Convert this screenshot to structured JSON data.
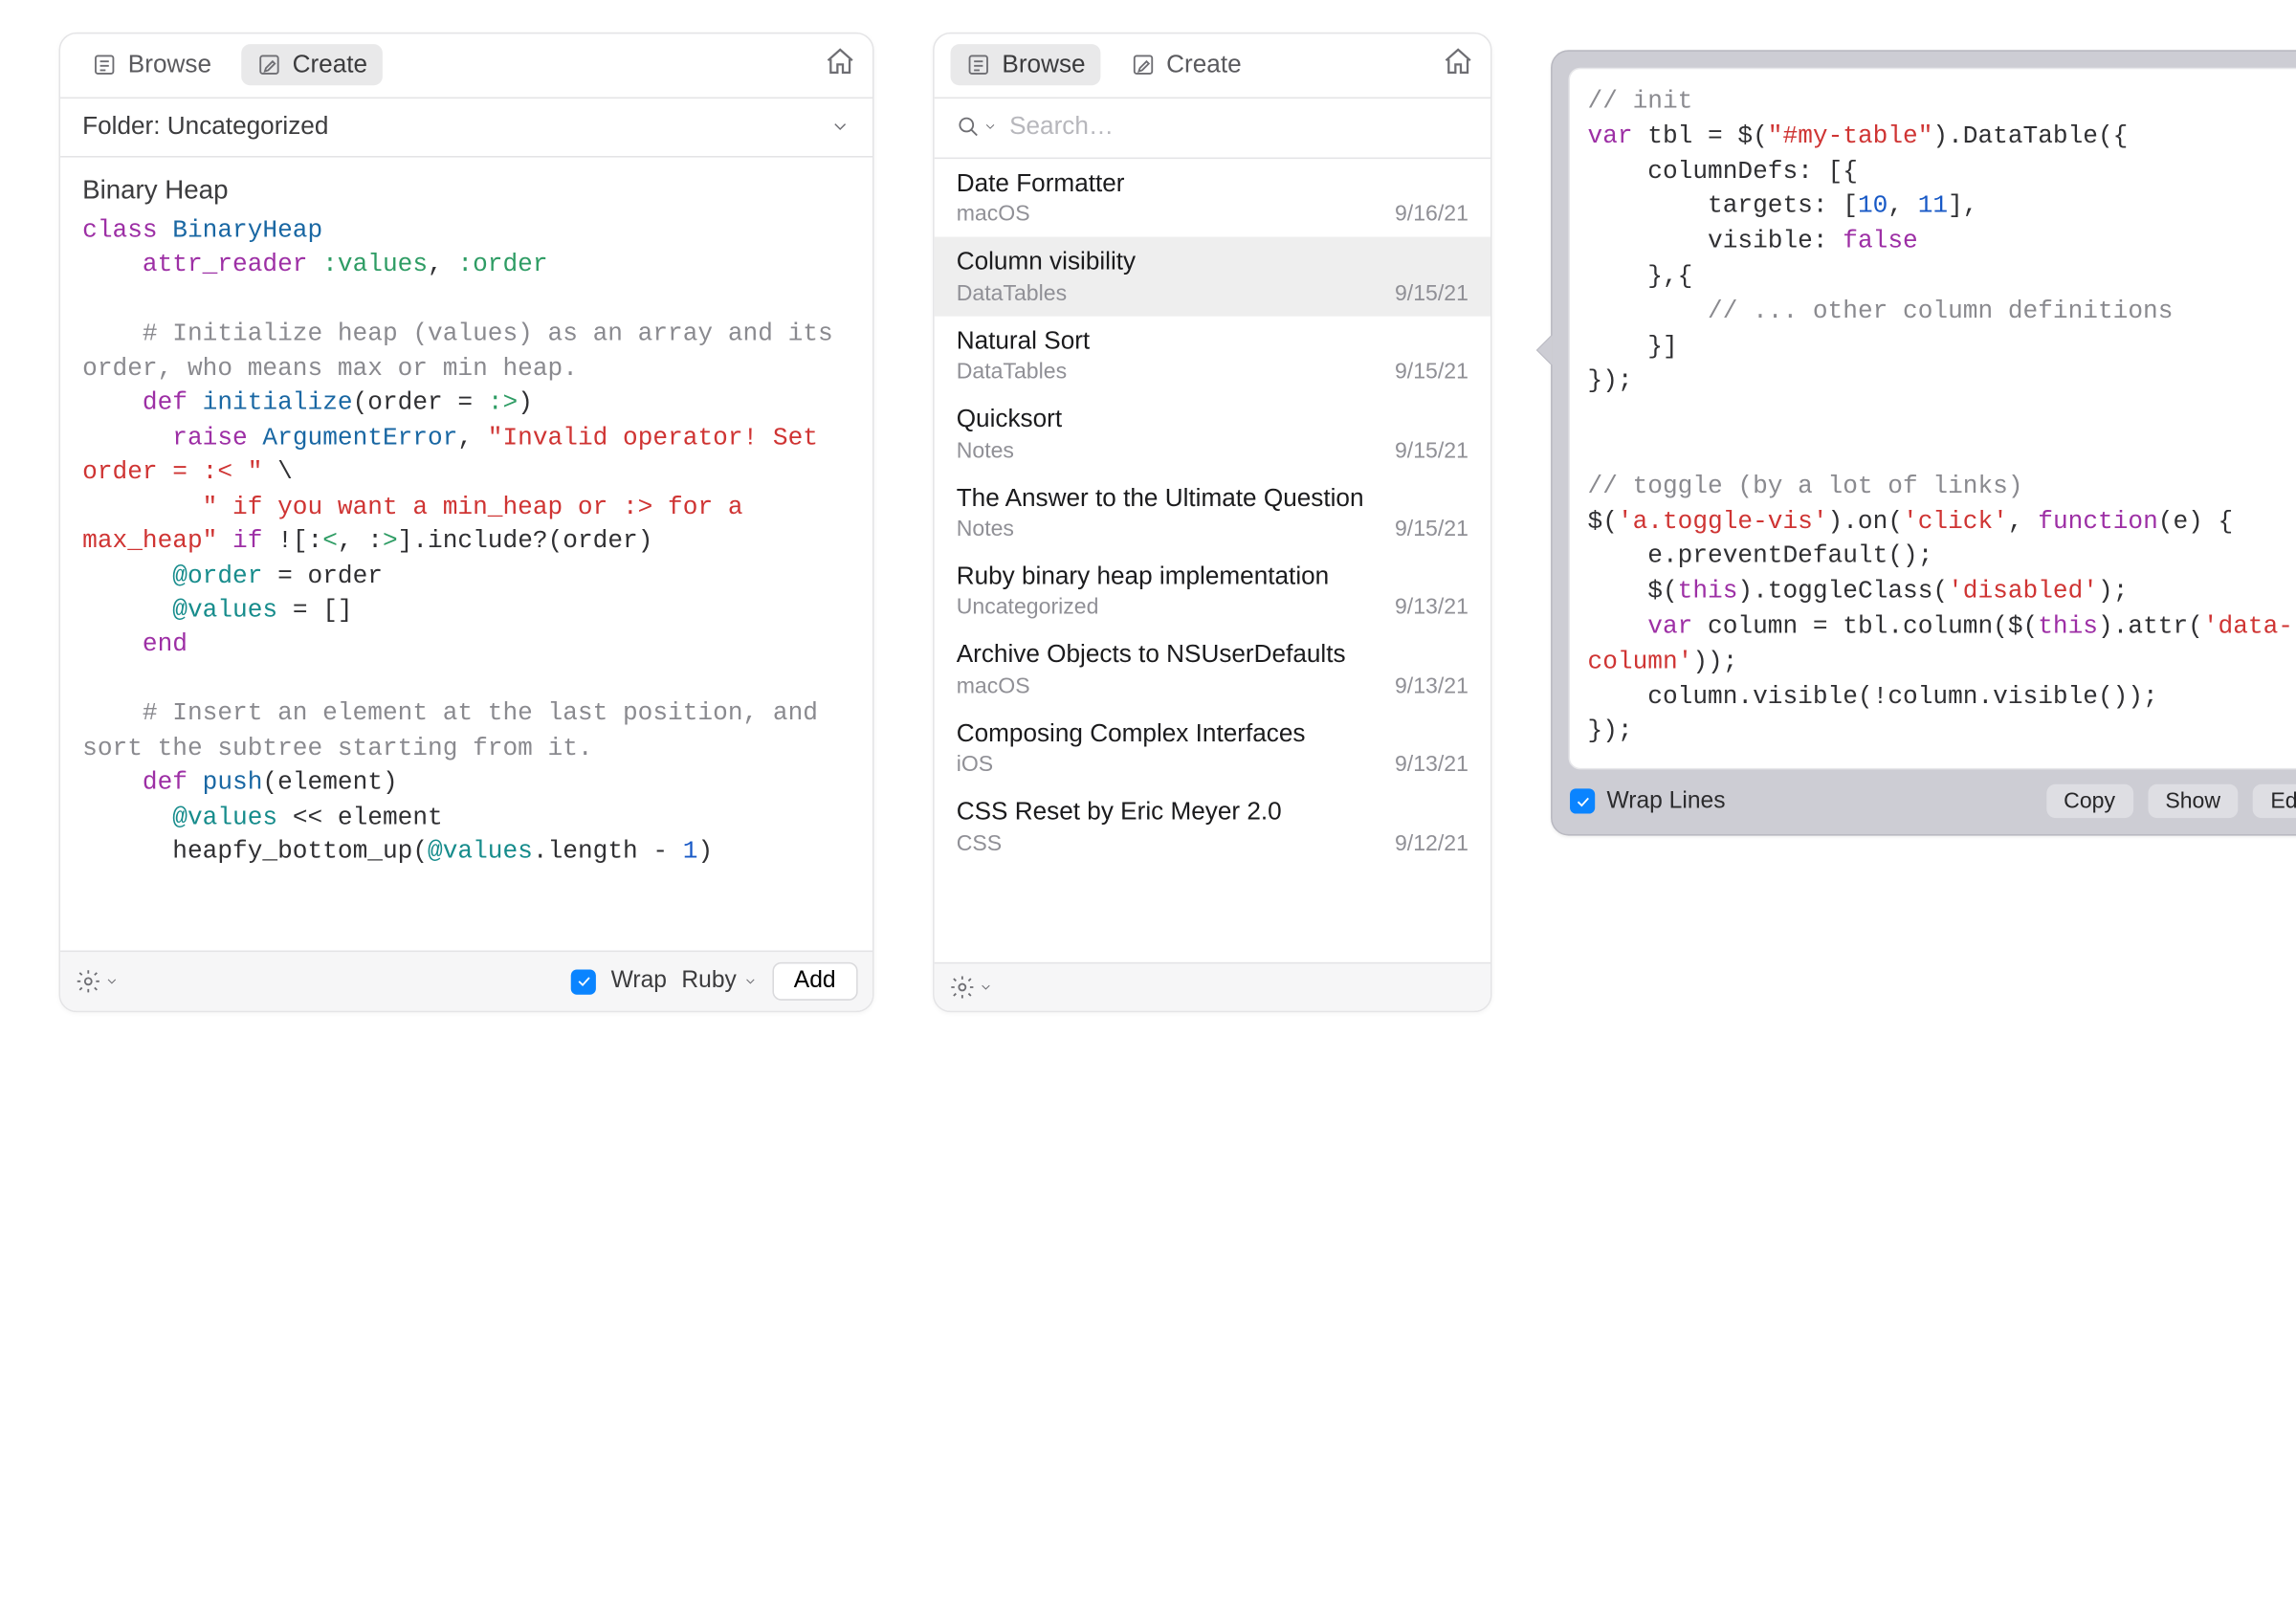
{
  "panel1": {
    "browse": "Browse",
    "create": "Create",
    "folder_label": "Folder: Uncategorized",
    "title": "Binary Heap",
    "footer": {
      "wrap_label": "Wrap",
      "lang": "Ruby",
      "add": "Add"
    },
    "code_tokens": [
      [
        [
          "kw",
          "class"
        ],
        [
          "",
          " "
        ],
        [
          "dfn",
          "BinaryHeap"
        ]
      ],
      [
        [
          "",
          "    "
        ],
        [
          "kw",
          "attr_reader"
        ],
        [
          "",
          " "
        ],
        [
          "sym",
          ":values"
        ],
        [
          "",
          ", "
        ],
        [
          "sym",
          ":order"
        ]
      ],
      [],
      [
        [
          "",
          "    "
        ],
        [
          "cmt",
          "# Initialize heap (values) as an array and its order, who means max or min heap."
        ]
      ],
      [
        [
          "",
          "    "
        ],
        [
          "kw",
          "def"
        ],
        [
          "",
          " "
        ],
        [
          "dfn",
          "initialize"
        ],
        [
          "",
          "(order = "
        ],
        [
          "sym",
          ":>"
        ],
        [
          "",
          ")"
        ]
      ],
      [
        [
          "",
          "      "
        ],
        [
          "kw",
          "raise"
        ],
        [
          "",
          " "
        ],
        [
          "dfn",
          "ArgumentError"
        ],
        [
          "",
          ", "
        ],
        [
          "str",
          "\"Invalid operator! Set order = :< \""
        ],
        [
          "",
          " \\"
        ]
      ],
      [
        [
          "",
          "        "
        ],
        [
          "str",
          "\" if you want a min_heap or :> for a max_heap\""
        ],
        [
          "",
          " "
        ],
        [
          "kw",
          "if"
        ],
        [
          "",
          " ![:"
        ],
        [
          "sym",
          "<"
        ],
        [
          "",
          ", :"
        ],
        [
          "sym",
          ">"
        ],
        [
          "",
          "].include?(order)"
        ]
      ],
      [
        [
          "",
          "      "
        ],
        [
          "atr",
          "@order"
        ],
        [
          "",
          " = order"
        ]
      ],
      [
        [
          "",
          "      "
        ],
        [
          "atr",
          "@values"
        ],
        [
          "",
          " = []"
        ]
      ],
      [
        [
          "",
          "    "
        ],
        [
          "kw",
          "end"
        ]
      ],
      [],
      [
        [
          "",
          "    "
        ],
        [
          "cmt",
          "# Insert an element at the last position, and sort the subtree starting from it."
        ]
      ],
      [
        [
          "",
          "    "
        ],
        [
          "kw",
          "def"
        ],
        [
          "",
          " "
        ],
        [
          "dfn",
          "push"
        ],
        [
          "",
          "(element)"
        ]
      ],
      [
        [
          "",
          "      "
        ],
        [
          "atr",
          "@values"
        ],
        [
          "",
          " << element"
        ]
      ],
      [
        [
          "",
          "      heapfy_bottom_up("
        ],
        [
          "atr",
          "@values"
        ],
        [
          "",
          ".length - "
        ],
        [
          "num",
          "1"
        ],
        [
          "",
          ")"
        ]
      ]
    ]
  },
  "panel2": {
    "browse": "Browse",
    "create": "Create",
    "search_placeholder": "Search…",
    "items": [
      {
        "title": "Date Formatter",
        "folder": "macOS",
        "date": "9/16/21",
        "sel": false
      },
      {
        "title": "Column visibility",
        "folder": "DataTables",
        "date": "9/15/21",
        "sel": true
      },
      {
        "title": "Natural Sort",
        "folder": "DataTables",
        "date": "9/15/21",
        "sel": false
      },
      {
        "title": "Quicksort",
        "folder": "Notes",
        "date": "9/15/21",
        "sel": false
      },
      {
        "title": "The Answer to the Ultimate Question",
        "folder": "Notes",
        "date": "9/15/21",
        "sel": false
      },
      {
        "title": "Ruby binary heap implementation",
        "folder": "Uncategorized",
        "date": "9/13/21",
        "sel": false
      },
      {
        "title": "Archive Objects to NSUserDefaults",
        "folder": "macOS",
        "date": "9/13/21",
        "sel": false
      },
      {
        "title": "Composing Complex Interfaces",
        "folder": "iOS",
        "date": "9/13/21",
        "sel": false
      },
      {
        "title": "CSS Reset by Eric Meyer 2.0",
        "folder": "CSS",
        "date": "9/12/21",
        "sel": false
      }
    ]
  },
  "callout": {
    "wrap_label": "Wrap Lines",
    "copy": "Copy",
    "show": "Show",
    "edit": "Edit",
    "code_tokens": [
      [
        [
          "cmt",
          "// init"
        ]
      ],
      [
        [
          "kw",
          "var"
        ],
        [
          "",
          " tbl = $("
        ],
        [
          "str",
          "\"#my-table\""
        ],
        [
          "",
          ").DataTable({"
        ]
      ],
      [
        [
          "",
          "    columnDefs: [{"
        ]
      ],
      [
        [
          "",
          "        targets: ["
        ],
        [
          "num",
          "10"
        ],
        [
          "",
          ", "
        ],
        [
          "num",
          "11"
        ],
        [
          "",
          "],"
        ]
      ],
      [
        [
          "",
          "        visible: "
        ],
        [
          "bol",
          "false"
        ]
      ],
      [
        [
          "",
          "    },{"
        ]
      ],
      [
        [
          "",
          "        "
        ],
        [
          "cmt",
          "// ... other column definitions"
        ]
      ],
      [
        [
          "",
          "    }]"
        ]
      ],
      [
        [
          "",
          "});"
        ]
      ],
      [],
      [],
      [
        [
          "cmt",
          "// toggle (by a lot of links)"
        ]
      ],
      [
        [
          "",
          "$("
        ],
        [
          "str",
          "'a.toggle-vis'"
        ],
        [
          "",
          ").on("
        ],
        [
          "str",
          "'click'"
        ],
        [
          "",
          ", "
        ],
        [
          "kw",
          "function"
        ],
        [
          "",
          "(e) {"
        ]
      ],
      [
        [
          "",
          "    e.preventDefault();"
        ]
      ],
      [
        [
          "",
          "    $("
        ],
        [
          "kw",
          "this"
        ],
        [
          "",
          ").toggleClass("
        ],
        [
          "str",
          "'disabled'"
        ],
        [
          "",
          ");"
        ]
      ],
      [
        [
          "",
          "    "
        ],
        [
          "kw",
          "var"
        ],
        [
          "",
          " column = tbl.column($("
        ],
        [
          "kw",
          "this"
        ],
        [
          "",
          ").attr("
        ],
        [
          "str",
          "'data-column'"
        ],
        [
          "",
          "));"
        ]
      ],
      [
        [
          "",
          "    column.visible(!column.visible());"
        ]
      ],
      [
        [
          "",
          "});"
        ]
      ]
    ]
  }
}
